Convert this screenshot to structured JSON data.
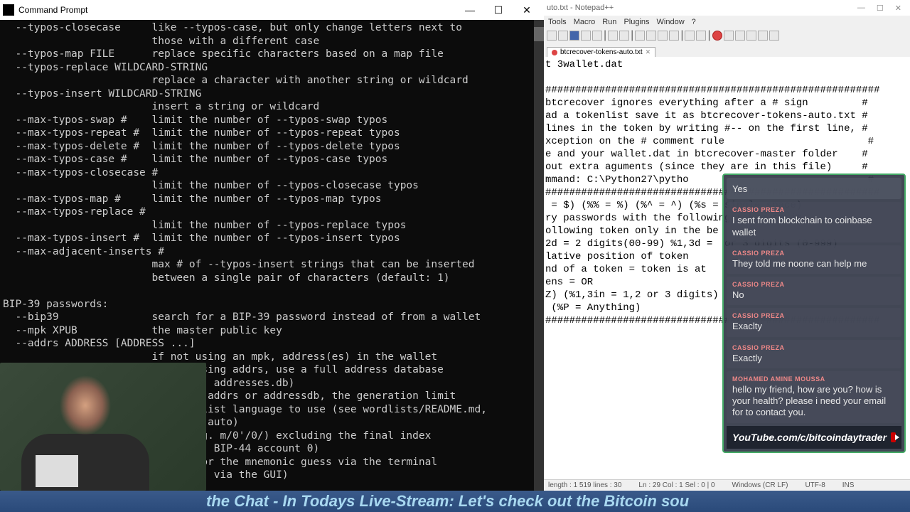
{
  "cmd": {
    "title": "Command Prompt",
    "btn_min": "—",
    "btn_max": "☐",
    "btn_close": "✕",
    "lines": [
      "  --typos-closecase     like --typos-case, but only change letters next to",
      "                        those with a different case",
      "  --typos-map FILE      replace specific characters based on a map file",
      "  --typos-replace WILDCARD-STRING",
      "                        replace a character with another string or wildcard",
      "  --typos-insert WILDCARD-STRING",
      "                        insert a string or wildcard",
      "  --max-typos-swap #    limit the number of --typos-swap typos",
      "  --max-typos-repeat #  limit the number of --typos-repeat typos",
      "  --max-typos-delete #  limit the number of --typos-delete typos",
      "  --max-typos-case #    limit the number of --typos-case typos",
      "  --max-typos-closecase #",
      "                        limit the number of --typos-closecase typos",
      "  --max-typos-map #     limit the number of --typos-map typos",
      "  --max-typos-replace #",
      "                        limit the number of --typos-replace typos",
      "  --max-typos-insert #  limit the number of --typos-insert typos",
      "  --max-adjacent-inserts #",
      "                        max # of --typos-insert strings that can be inserted",
      "                        between a single pair of characters (default: 1)",
      "",
      "BIP-39 passwords:",
      "  --bip39               search for a BIP-39 password instead of from a wallet",
      "  --mpk XPUB            the master public key",
      "  --addrs ADDRESS [ADDRESS ...]",
      "                        if not using an mpk, address(es) in the wallet",
      "  --addressdb [FILE]    if not using addrs, use a full address database",
      "                        (default: addresses.db)",
      "  --addr-limit COUNT    if using addrs or addressdb, the generation limit",
      "  --language LANG-CODE  the wordlist language to use (see wordlists/README.md,",
      "                        default: auto)",
      "  --bip32-path PATH     path (e.g. m/0'/0/) excluding the final index",
      "                        (default: BIP-44 account 0)",
      "  --mnemonic-prompt     prompt for the mnemonic guess via the terminal",
      "                        (default: via the GUI)"
    ]
  },
  "npp": {
    "title": "uto.txt - Notepad++",
    "menu": [
      "Tools",
      "Macro",
      "Run",
      "Plugins",
      "Window",
      "?"
    ],
    "tab_label": "btcrecover-tokens-auto.txt",
    "tab_close": "✕",
    "winbtn_min": "—",
    "winbtn_max": "☐",
    "winbtn_close": "✕",
    "lines": [
      "t 3wallet.dat",
      "",
      "########################################################",
      "btcrecover ignores everything after a # sign         #",
      "ad a tokenlist save it as btcrecover-tokens-auto.txt #",
      "lines in the token by writing #-- on the first line, #",
      "xception on the # comment rule                        #",
      "e and your wallet.dat in btcrecover-master folder    #",
      "out extra aguments (since they are in this file)     #",
      "mmand: C:\\Python27\\pytho                              #",
      "########################################################",
      " = $) (%% = %) (%^ = ^) (%s = single space)",
      "ry passwords with the following token in it.",
      "ollowing token only in the be",
      "2d = 2 digits(00-99) %1,3d =  or 3 digits (0-999)",
      "lative position of token",
      "nd of a token = token is at ",
      "ens = OR",
      "Z) (%1,3in = 1,2 or 3 digits)",
      " (%P = Anything)",
      "########################################################"
    ],
    "status": {
      "length": "length : 1 519   lines : 30",
      "pos": "Ln : 29   Col : 1   Sel : 0 | 0",
      "eol": "Windows (CR LF)",
      "enc": "UTF-8",
      "mode": "INS"
    }
  },
  "chat": {
    "messages": [
      {
        "author": "",
        "text": "Yes",
        "self": true
      },
      {
        "author": "CASSIO PREZA",
        "text": "I sent from blockchain to coinbase wallet",
        "self": false
      },
      {
        "author": "CASSIO PREZA",
        "text": "They told me noone can help me",
        "self": false
      },
      {
        "author": "CASSIO PREZA",
        "text": "No",
        "self": false
      },
      {
        "author": "CASSIO PREZA",
        "text": "Exaclty",
        "self": false
      },
      {
        "author": "CASSIO PREZA",
        "text": "Exactly",
        "self": false
      },
      {
        "author": "MOHAMED AMINE MOUSSA",
        "text": "hello my friend, how are you? how is your health? please i need your email for to contact you.",
        "self": false
      }
    ],
    "youtube": "YouTube.com/c/bitcoindaytrader"
  },
  "ticker": {
    "text": " the Chat - In Todays Live-Stream: Let's check out the Bitcoin sou"
  }
}
